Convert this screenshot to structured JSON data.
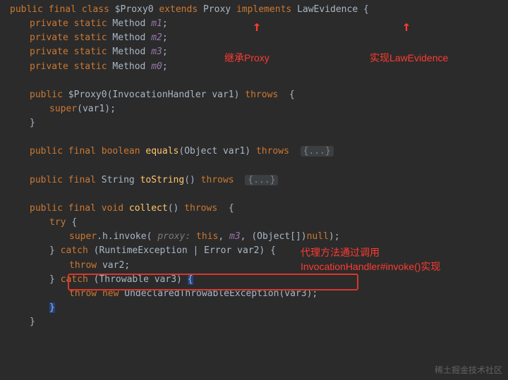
{
  "code": {
    "l1": {
      "public": "public",
      "final": "final",
      "class": "class",
      "name": "$Proxy0",
      "extends": "extends",
      "superclass": "Proxy",
      "implements": "implements",
      "iface": "LawEvidence",
      "brace": "{"
    },
    "fields": {
      "private": "private",
      "static": "static",
      "type": "Method",
      "m1": "m1",
      "m2": "m2",
      "m3": "m3",
      "m0": "m0",
      "semi": ";"
    },
    "ctor": {
      "public": "public",
      "name": "$Proxy0",
      "paramType": "InvocationHandler",
      "paramName": "var1",
      "throws": "throws",
      "brace": "{",
      "superCall": "super",
      "arg": "var1",
      "close": ");",
      "cbrace": "}"
    },
    "equals": {
      "public": "public",
      "final": "final",
      "ret": "boolean",
      "name": "equals",
      "pType": "Object",
      "pName": "var1",
      "throws": "throws",
      "fold": "{...}"
    },
    "toString": {
      "public": "public",
      "final": "final",
      "ret": "String",
      "name": "toString",
      "throws": "throws",
      "fold": "{...}"
    },
    "collect": {
      "public": "public",
      "final": "final",
      "ret": "void",
      "name": "collect",
      "throws": "throws",
      "brace": "{",
      "try": "try",
      "obrace": "{",
      "invokePre": "super.h.",
      "invoke": "invoke",
      "hint": "proxy: ",
      "thisKw": "this",
      "m3": "m3",
      "cast": "(Object[])",
      "null": "null",
      "end": ");",
      "catch1": "catch",
      "ex1": "(RuntimeException | Error var2)",
      "cbrace1": "{",
      "throw1": "throw",
      "v2": "var2",
      "semi": ";",
      "catch2": "catch",
      "ex2": "(Throwable var3)",
      "cbrace2": "{",
      "throw2": "throw",
      "new": "new",
      "utx": "UndeclaredThrowableException",
      "v3": "(var3)",
      "semi2": ";",
      "close": "}"
    }
  },
  "annotations": {
    "extendsProxy": "继承Proxy",
    "implLaw": "实现LawEvidence",
    "invokeNote1": "代理方法通过调用",
    "invokeNote2": "InvocationHandler#invoke()实现"
  },
  "watermark": "稀土掘金技术社区"
}
